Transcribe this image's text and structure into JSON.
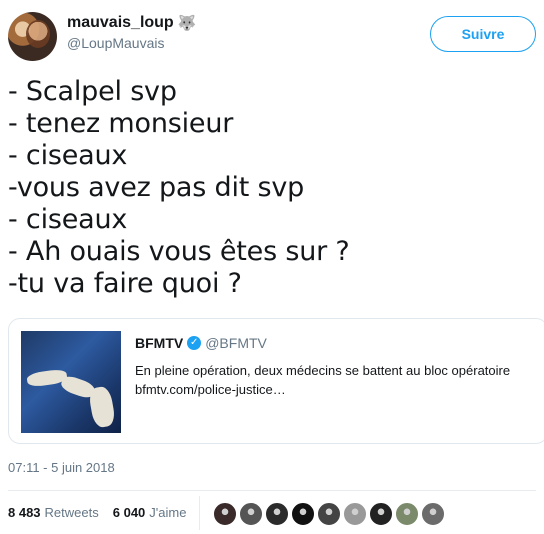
{
  "user": {
    "display_name": "mauvais_loup",
    "display_emoji": "🐺",
    "handle": "@LoupMauvais",
    "follow_label": "Suivre"
  },
  "tweet": {
    "lines": [
      "- Scalpel svp",
      "- tenez monsieur",
      "- ciseaux",
      "-vous avez pas dit svp",
      "- ciseaux",
      "- Ah ouais vous êtes sur ?",
      "-tu va faire quoi ?"
    ]
  },
  "card": {
    "source_name": "BFMTV",
    "source_handle": "@BFMTV",
    "description": "En pleine opération, deux médecins se battent au bloc opératoire",
    "link": "bfmtv.com/police-justice…"
  },
  "timestamp": "07:11 - 5 juin 2018",
  "stats": {
    "retweets_value": "8 483",
    "retweets_label": "Retweets",
    "likes_value": "6 040",
    "likes_label": "J'aime"
  },
  "likers": {
    "colors": [
      "#3a2a2a",
      "#555555",
      "#2b2b2b",
      "#111111",
      "#444444",
      "#999999",
      "#222222",
      "#7a8a6a",
      "#6b6b6b"
    ]
  },
  "colors": {
    "accent": "#1da1f2",
    "text": "#14171a",
    "muted": "#657786"
  }
}
